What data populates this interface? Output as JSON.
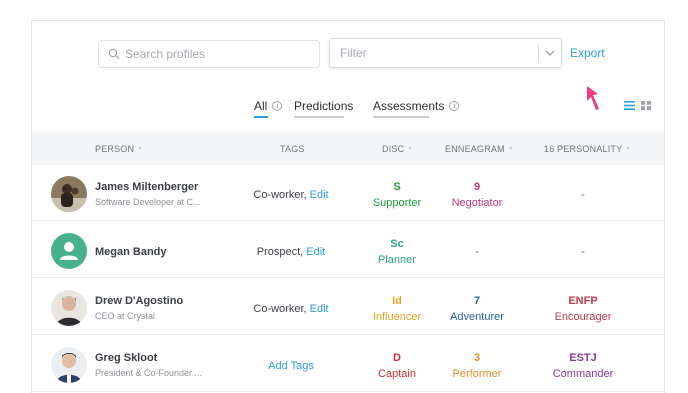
{
  "search": {
    "placeholder": "Search profiles"
  },
  "filter": {
    "placeholder": "Filter"
  },
  "export_label": "Export",
  "tabs": [
    {
      "label": "All",
      "active": true
    },
    {
      "label": "Predictions",
      "active": false
    },
    {
      "label": "Assessments",
      "active": false
    }
  ],
  "columns": {
    "person": "PERSON",
    "tags": "TAGS",
    "disc": "DISC",
    "enneagram": "ENNEAGRAM",
    "personality": "16 PERSONALITY"
  },
  "rows": [
    {
      "name": "James Miltenberger",
      "subtitle": "Software Developer at C...",
      "tag": "Co-worker,",
      "edit": "Edit",
      "disc_code": "S",
      "disc_desc": "Supporter",
      "disc_color": "#1e9e3e",
      "enn_code": "9",
      "enn_desc": "Negotiator",
      "enn_color": "#c2367a",
      "pers_code": "-",
      "pers_desc": "",
      "pers_color": "#5a5f65",
      "avatar": "photo"
    },
    {
      "name": "Megan Bandy",
      "subtitle": "",
      "tag": "Prospect,",
      "edit": "Edit",
      "disc_code": "Sc",
      "disc_desc": "Planner",
      "disc_color": "#2aa58b",
      "enn_code": "-",
      "enn_desc": "",
      "enn_color": "#5a5f65",
      "pers_code": "-",
      "pers_desc": "",
      "pers_color": "#5a5f65",
      "avatar": "placeholder"
    },
    {
      "name": "Drew D'Agostino",
      "subtitle": "CEO at Crystal",
      "tag": "Co-worker,",
      "edit": "Edit",
      "disc_code": "Id",
      "disc_desc": "Influencer",
      "disc_color": "#e8a71f",
      "enn_code": "7",
      "enn_desc": "Adventurer",
      "enn_color": "#25649b",
      "pers_code": "ENFP",
      "pers_desc": "Encourager",
      "pers_color": "#c23c4a",
      "avatar": "photo"
    },
    {
      "name": "Greg Skloot",
      "subtitle": "President & Co-Founder ...",
      "tag": "",
      "edit": "Add Tags",
      "disc_code": "D",
      "disc_desc": "Captain",
      "disc_color": "#cc2f3a",
      "enn_code": "3",
      "enn_desc": "Performer",
      "enn_color": "#e0922a",
      "pers_code": "ESTJ",
      "pers_desc": "Commander",
      "pers_color": "#8a3a9c",
      "avatar": "photo"
    }
  ],
  "colors": {
    "accent": "#2f9ed8",
    "pointer": "#e93d7f",
    "avatar_placeholder": "#49b08f"
  }
}
